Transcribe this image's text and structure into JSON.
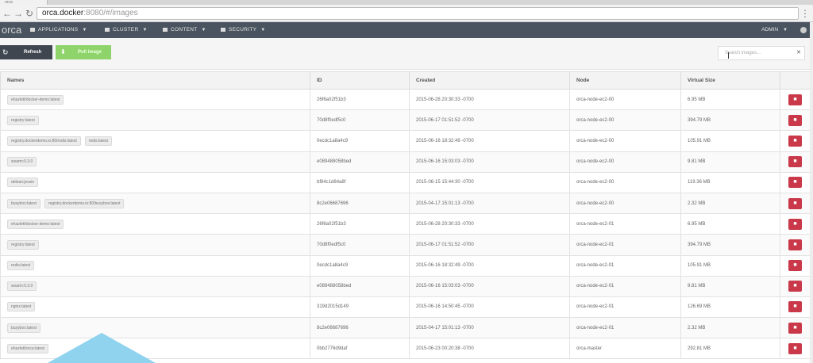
{
  "browser": {
    "tab_title": "orca",
    "url_host": "orca.docker",
    "url_path": ":8080/#/images"
  },
  "navbar": {
    "brand": "orca",
    "items": [
      {
        "label": "APPLICATIONS"
      },
      {
        "label": "CLUSTER"
      },
      {
        "label": "CONTENT"
      },
      {
        "label": "SECURITY"
      }
    ],
    "user": "ADMIN"
  },
  "toolbar": {
    "refresh_label": "Refresh",
    "pull_label": "Pull image",
    "search_placeholder": "Search images..."
  },
  "table": {
    "headers": {
      "names": "Names",
      "id": "ID",
      "created": "Created",
      "node": "Node",
      "size": "Virtual Size"
    },
    "rows": [
      {
        "names": [
          "ehazlett/docker-demo:latest"
        ],
        "id": "26f6a02f51b3",
        "created": "2015-06-28 20:30:33 -0700",
        "node": "orca-node-ec2-00",
        "size": "6.95 MB"
      },
      {
        "names": [
          "registry:latest"
        ],
        "id": "70d8f0edf5c0",
        "created": "2015-06-17 01:51:52 -0700",
        "node": "orca-node-ec2-00",
        "size": "394.79 MB"
      },
      {
        "names": [
          "registry.dockerdemo.io:80/redis:latest",
          "redis:latest"
        ],
        "id": "0ecdc1a8a4c9",
        "created": "2015-06-16 18:32:49 -0700",
        "node": "orca-node-ec2-00",
        "size": "105.91 MB"
      },
      {
        "names": [
          "swarm:0.3.0"
        ],
        "id": "e089488058bed",
        "created": "2015-06-16 15:03:03 -0700",
        "node": "orca-node-ec2-00",
        "size": "9.81 MB"
      },
      {
        "names": [
          "debian:jessie"
        ],
        "id": "bf84c1d84a8f",
        "created": "2015-06-15 15:44:30 -0700",
        "node": "orca-node-ec2-00",
        "size": "119.36 MB"
      },
      {
        "names": [
          "busybox:latest",
          "registry.dockerdemo.io:80/busybox:latest"
        ],
        "id": "8c2e06687696",
        "created": "2015-04-17 15:01:13 -0700",
        "node": "orca-node-ec2-00",
        "size": "2.32 MB"
      },
      {
        "names": [
          "ehazlett/docker-demo:latest"
        ],
        "id": "26f6a02f51b3",
        "created": "2015-06-28 20:30:33 -0700",
        "node": "orca-node-ec2-01",
        "size": "6.95 MB"
      },
      {
        "names": [
          "registry:latest"
        ],
        "id": "70d8f0edf5c0",
        "created": "2015-06-17 01:51:52 -0700",
        "node": "orca-node-ec2-01",
        "size": "394.79 MB"
      },
      {
        "names": [
          "redis:latest"
        ],
        "id": "0ecdc1a8a4c9",
        "created": "2015-06-16 18:32:49 -0700",
        "node": "orca-node-ec2-01",
        "size": "105.91 MB"
      },
      {
        "names": [
          "swarm:0.3.0"
        ],
        "id": "e089488058bed",
        "created": "2015-06-16 15:03:03 -0700",
        "node": "orca-node-ec2-01",
        "size": "9.81 MB"
      },
      {
        "names": [
          "nginx:latest"
        ],
        "id": "319d2015d149",
        "created": "2015-06-16 14:50:45 -0700",
        "node": "orca-node-ec2-01",
        "size": "126.69 MB"
      },
      {
        "names": [
          "busybox:latest"
        ],
        "id": "8c2e06687696",
        "created": "2015-04-17 15:01:13 -0700",
        "node": "orca-node-ec2-01",
        "size": "2.32 MB"
      },
      {
        "names": [
          "ehazlett/orca:latest"
        ],
        "id": "0bb2776d9daf",
        "created": "2015-06-23 00:20:38 -0700",
        "node": "orca-master",
        "size": "292.81 MB"
      }
    ]
  },
  "icons": {
    "back": "back-arrow-icon",
    "forward": "forward-arrow-icon",
    "reload": "reload-icon",
    "refresh": "refresh-icon",
    "pull": "download-icon",
    "delete": "trash-icon"
  },
  "colors": {
    "navbar": "#4a5460",
    "refresh_button": "#3f4650",
    "pull_button": "#8fd46b",
    "delete_button": "#c9394a"
  }
}
